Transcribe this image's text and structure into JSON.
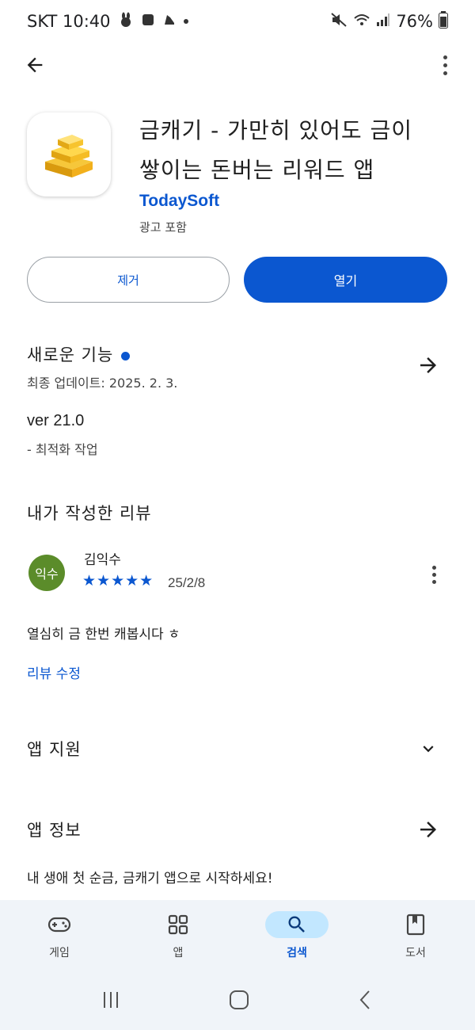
{
  "status": {
    "carrier_time": "SKT 10:40",
    "battery": "76%"
  },
  "app": {
    "title_line1": "금캐기 - 가만히 있어도 금이",
    "title_line2": "쌓이는 돈버는 리워드 앱",
    "developer": "TodaySoft",
    "ads_note": "광고 포함"
  },
  "actions": {
    "uninstall": "제거",
    "open": "열기"
  },
  "whats_new": {
    "title": "새로운 기능",
    "updated": "최종 업데이트: 2025. 2. 3.",
    "version": "ver 21.0",
    "note": "- 최적화 작업"
  },
  "my_review": {
    "section_title": "내가 작성한 리뷰",
    "avatar_text": "익수",
    "name": "김익수",
    "stars": "★★★★★",
    "rating": 5,
    "date": "25/2/8",
    "text": "열심히 금 한번 캐봅시다 ㅎ",
    "edit_label": "리뷰 수정"
  },
  "app_support": {
    "title": "앱 지원"
  },
  "app_info": {
    "title": "앱 정보",
    "description": "내 생애 첫 순금, 금캐기 앱으로 시작하세요!"
  },
  "bottom_nav": {
    "games": "게임",
    "apps": "앱",
    "search": "검색",
    "books": "도서"
  },
  "colors": {
    "accent": "#0b57d0",
    "active_pill": "#c2e7ff",
    "avatar": "#5b8c2a",
    "nav_bg": "#f0f4f9"
  }
}
